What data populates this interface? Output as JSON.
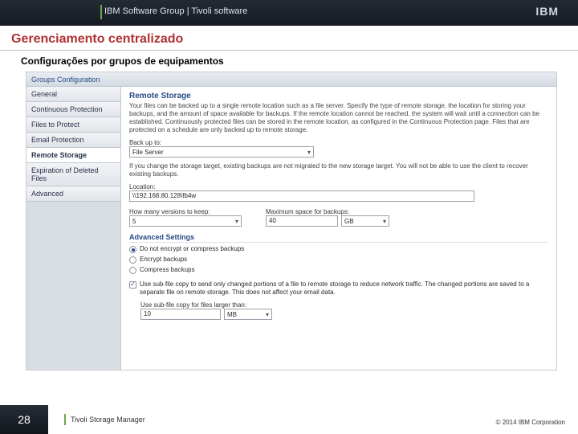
{
  "header": {
    "band_title": "IBM Software Group  |  Tivoli software",
    "ibm_logo": "IBM"
  },
  "slide": {
    "title": "Gerenciamento centralizado",
    "subtitle": "Configurações por grupos de equipamentos"
  },
  "screenshot": {
    "breadcrumb": "Groups Configuration",
    "nav": [
      "General",
      "Continuous Protection",
      "Files to Protect",
      "Email Protection",
      "Remote Storage",
      "Expiration of Deleted Files",
      "Advanced"
    ],
    "nav_active_index": 4,
    "panel": {
      "heading": "Remote Storage",
      "description": "Your files can be backed up to a single remote location such as a file server. Specify the type of remote storage, the location for storing your backups, and the amount of space available for backups. If the remote location cannot be reached, the system will wait until a connection can be established. Continuously protected files can be stored in the remote location, as configured in the Continuous Protection page. Files that are protected on a schedule are only backed up to remote storage.",
      "backup_label": "Back up to:",
      "backup_value": "File Server",
      "change_note": "If you change the storage target, existing backups are not migrated to the new storage target. You will not be able to use the client to recover existing backups.",
      "location_label": "Location:",
      "location_value": "\\\\192.168.80.128\\fb4w",
      "versions_label": "How many versions to keep:",
      "versions_value": "5",
      "maxspace_label": "Maximum space for backups:",
      "maxspace_value": "40",
      "maxspace_unit": "GB",
      "advanced_heading": "Advanced Settings",
      "enc_opts": [
        "Do not encrypt or compress backups",
        "Encrypt backups",
        "Compress backups"
      ],
      "enc_selected": 0,
      "subfile_label": "Use sub-file copy to send only changed portions of a file to remote storage to reduce network traffic. The changed portions are saved to a separate file on remote storage. This does not affect your email data.",
      "subfile_checked": true,
      "subfile_thresh_label": "Use sub-file copy for files larger than:",
      "subfile_thresh_value": "10",
      "subfile_thresh_unit": "MB"
    }
  },
  "footer": {
    "page_number": "28",
    "product": "Tivoli Storage Manager",
    "copyright": "© 2014 IBM Corporation"
  }
}
